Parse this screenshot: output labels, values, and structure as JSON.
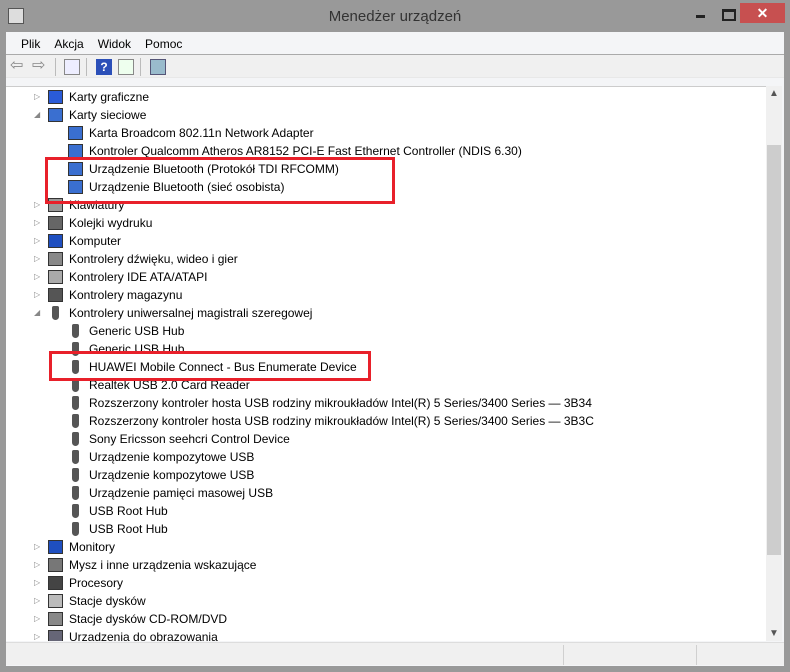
{
  "window": {
    "title": "Menedżer urządzeń",
    "close": "✕"
  },
  "menu": [
    "Plik",
    "Akcja",
    "Widok",
    "Pomoc"
  ],
  "toolbar": [
    "back-icon",
    "forward-icon",
    "show-hide-console-tree-icon",
    "help-icon",
    "action-pane-icon",
    "scan-hardware-icon"
  ],
  "tree": [
    {
      "label": "Karty graficzne",
      "level": 0,
      "state": "collapsed",
      "icon": "display-adapter-icon"
    },
    {
      "label": "Karty sieciowe",
      "level": 0,
      "state": "expanded",
      "icon": "network-adapter-icon"
    },
    {
      "label": "Karta Broadcom 802.11n Network Adapter",
      "level": 1,
      "icon": "network-adapter-icon"
    },
    {
      "label": "Kontroler Qualcomm Atheros AR8152 PCI-E Fast Ethernet Controller (NDIS 6.30)",
      "level": 1,
      "icon": "network-adapter-icon"
    },
    {
      "label": "Urządzenie Bluetooth (Protokół TDI RFCOMM)",
      "level": 1,
      "icon": "network-adapter-icon"
    },
    {
      "label": "Urządzenie Bluetooth (sieć osobista)",
      "level": 1,
      "icon": "network-adapter-icon"
    },
    {
      "label": "Klawiatury",
      "level": 0,
      "state": "collapsed",
      "icon": "keyboard-icon"
    },
    {
      "label": "Kolejki wydruku",
      "level": 0,
      "state": "collapsed",
      "icon": "printer-icon"
    },
    {
      "label": "Komputer",
      "level": 0,
      "state": "collapsed",
      "icon": "computer-icon"
    },
    {
      "label": "Kontrolery dźwięku, wideo i gier",
      "level": 0,
      "state": "collapsed",
      "icon": "speaker-icon"
    },
    {
      "label": "Kontrolery IDE ATA/ATAPI",
      "level": 0,
      "state": "collapsed",
      "icon": "ide-controller-icon"
    },
    {
      "label": "Kontrolery magazynu",
      "level": 0,
      "state": "collapsed",
      "icon": "storage-controller-icon"
    },
    {
      "label": "Kontrolery uniwersalnej magistrali szeregowej",
      "level": 0,
      "state": "expanded",
      "icon": "usb-icon"
    },
    {
      "label": "Generic USB Hub",
      "level": 1,
      "icon": "usb-icon"
    },
    {
      "label": "Generic USB Hub",
      "level": 1,
      "icon": "usb-icon"
    },
    {
      "label": "HUAWEI Mobile Connect - Bus Enumerate Device",
      "level": 1,
      "icon": "usb-icon"
    },
    {
      "label": "Realtek USB 2.0 Card Reader",
      "level": 1,
      "icon": "usb-icon"
    },
    {
      "label": "Rozszerzony kontroler hosta USB rodziny mikroukładów Intel(R) 5 Series/3400 Series — 3B34",
      "level": 1,
      "icon": "usb-icon"
    },
    {
      "label": "Rozszerzony kontroler hosta USB rodziny mikroukładów Intel(R) 5 Series/3400 Series — 3B3C",
      "level": 1,
      "icon": "usb-icon"
    },
    {
      "label": "Sony Ericsson seehcri Control Device",
      "level": 1,
      "icon": "usb-icon"
    },
    {
      "label": "Urządzenie kompozytowe USB",
      "level": 1,
      "icon": "usb-icon"
    },
    {
      "label": "Urządzenie kompozytowe USB",
      "level": 1,
      "icon": "usb-icon"
    },
    {
      "label": "Urządzenie pamięci masowej USB",
      "level": 1,
      "icon": "usb-icon"
    },
    {
      "label": "USB Root Hub",
      "level": 1,
      "icon": "usb-icon"
    },
    {
      "label": "USB Root Hub",
      "level": 1,
      "icon": "usb-icon"
    },
    {
      "label": "Monitory",
      "level": 0,
      "state": "collapsed",
      "icon": "monitor-icon"
    },
    {
      "label": "Mysz i inne urządzenia wskazujące",
      "level": 0,
      "state": "collapsed",
      "icon": "mouse-icon"
    },
    {
      "label": "Procesory",
      "level": 0,
      "state": "collapsed",
      "icon": "processor-icon"
    },
    {
      "label": "Stacje dysków",
      "level": 0,
      "state": "collapsed",
      "icon": "disk-drive-icon"
    },
    {
      "label": "Stacje dysków CD-ROM/DVD",
      "level": 0,
      "state": "collapsed",
      "icon": "cdrom-icon"
    },
    {
      "label": "Urządzenia do obrazowania",
      "level": 0,
      "state": "collapsed",
      "icon": "imaging-device-icon"
    }
  ],
  "highlight_color": "#e8202a",
  "scrollbar": {
    "position_percent": 12
  }
}
